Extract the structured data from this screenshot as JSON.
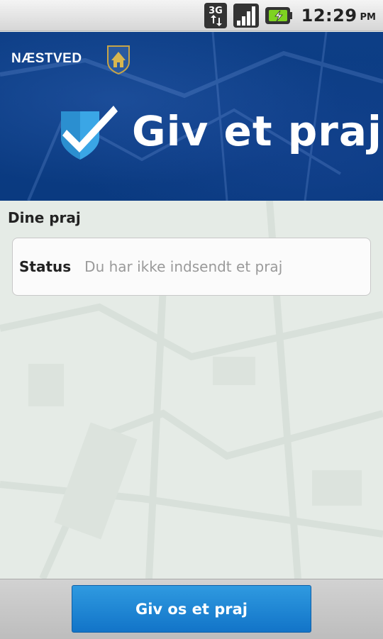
{
  "statusbar": {
    "network_label": "3G",
    "time": "12:29",
    "ampm": "PM"
  },
  "header": {
    "brand": "NÆSTVED",
    "title": "Giv et praj"
  },
  "main": {
    "section_title": "Dine praj",
    "status": {
      "label": "Status",
      "value": "Du har ikke indsendt et praj"
    }
  },
  "footer": {
    "cta_label": "Giv os et praj"
  }
}
